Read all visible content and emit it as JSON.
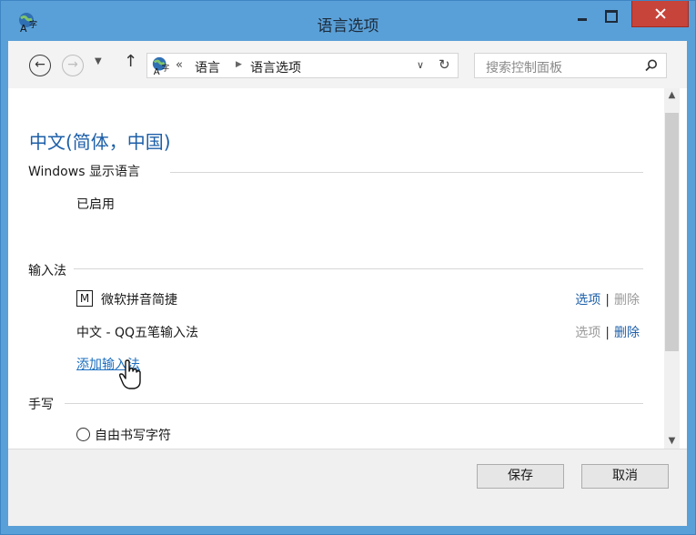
{
  "window": {
    "title": "语言选项"
  },
  "address": {
    "path": [
      "语言",
      "语言选项"
    ],
    "overflow": "«"
  },
  "search": {
    "placeholder": "搜索控制面板"
  },
  "content": {
    "heading": "中文(简体，中国)",
    "display_language": {
      "title": "Windows 显示语言",
      "status": "已启用"
    },
    "input_methods": {
      "title": "输入法",
      "items": [
        {
          "badge": "M",
          "name": "微软拼音简捷",
          "options": "选项",
          "remove": "删除",
          "options_enabled": true,
          "remove_enabled": false
        },
        {
          "badge": "",
          "name": "中文 - QQ五笔输入法",
          "options": "选项",
          "remove": "删除",
          "options_enabled": false,
          "remove_enabled": true
        }
      ],
      "add_link": "添加输入法",
      "separator": "|"
    },
    "handwriting": {
      "title": "手写",
      "option": "自由书写字符"
    }
  },
  "footer": {
    "save": "保存",
    "cancel": "取消"
  },
  "colors": {
    "titlebar": "#5aa0d8",
    "link": "#1d5fa8",
    "close": "#c7443a"
  }
}
